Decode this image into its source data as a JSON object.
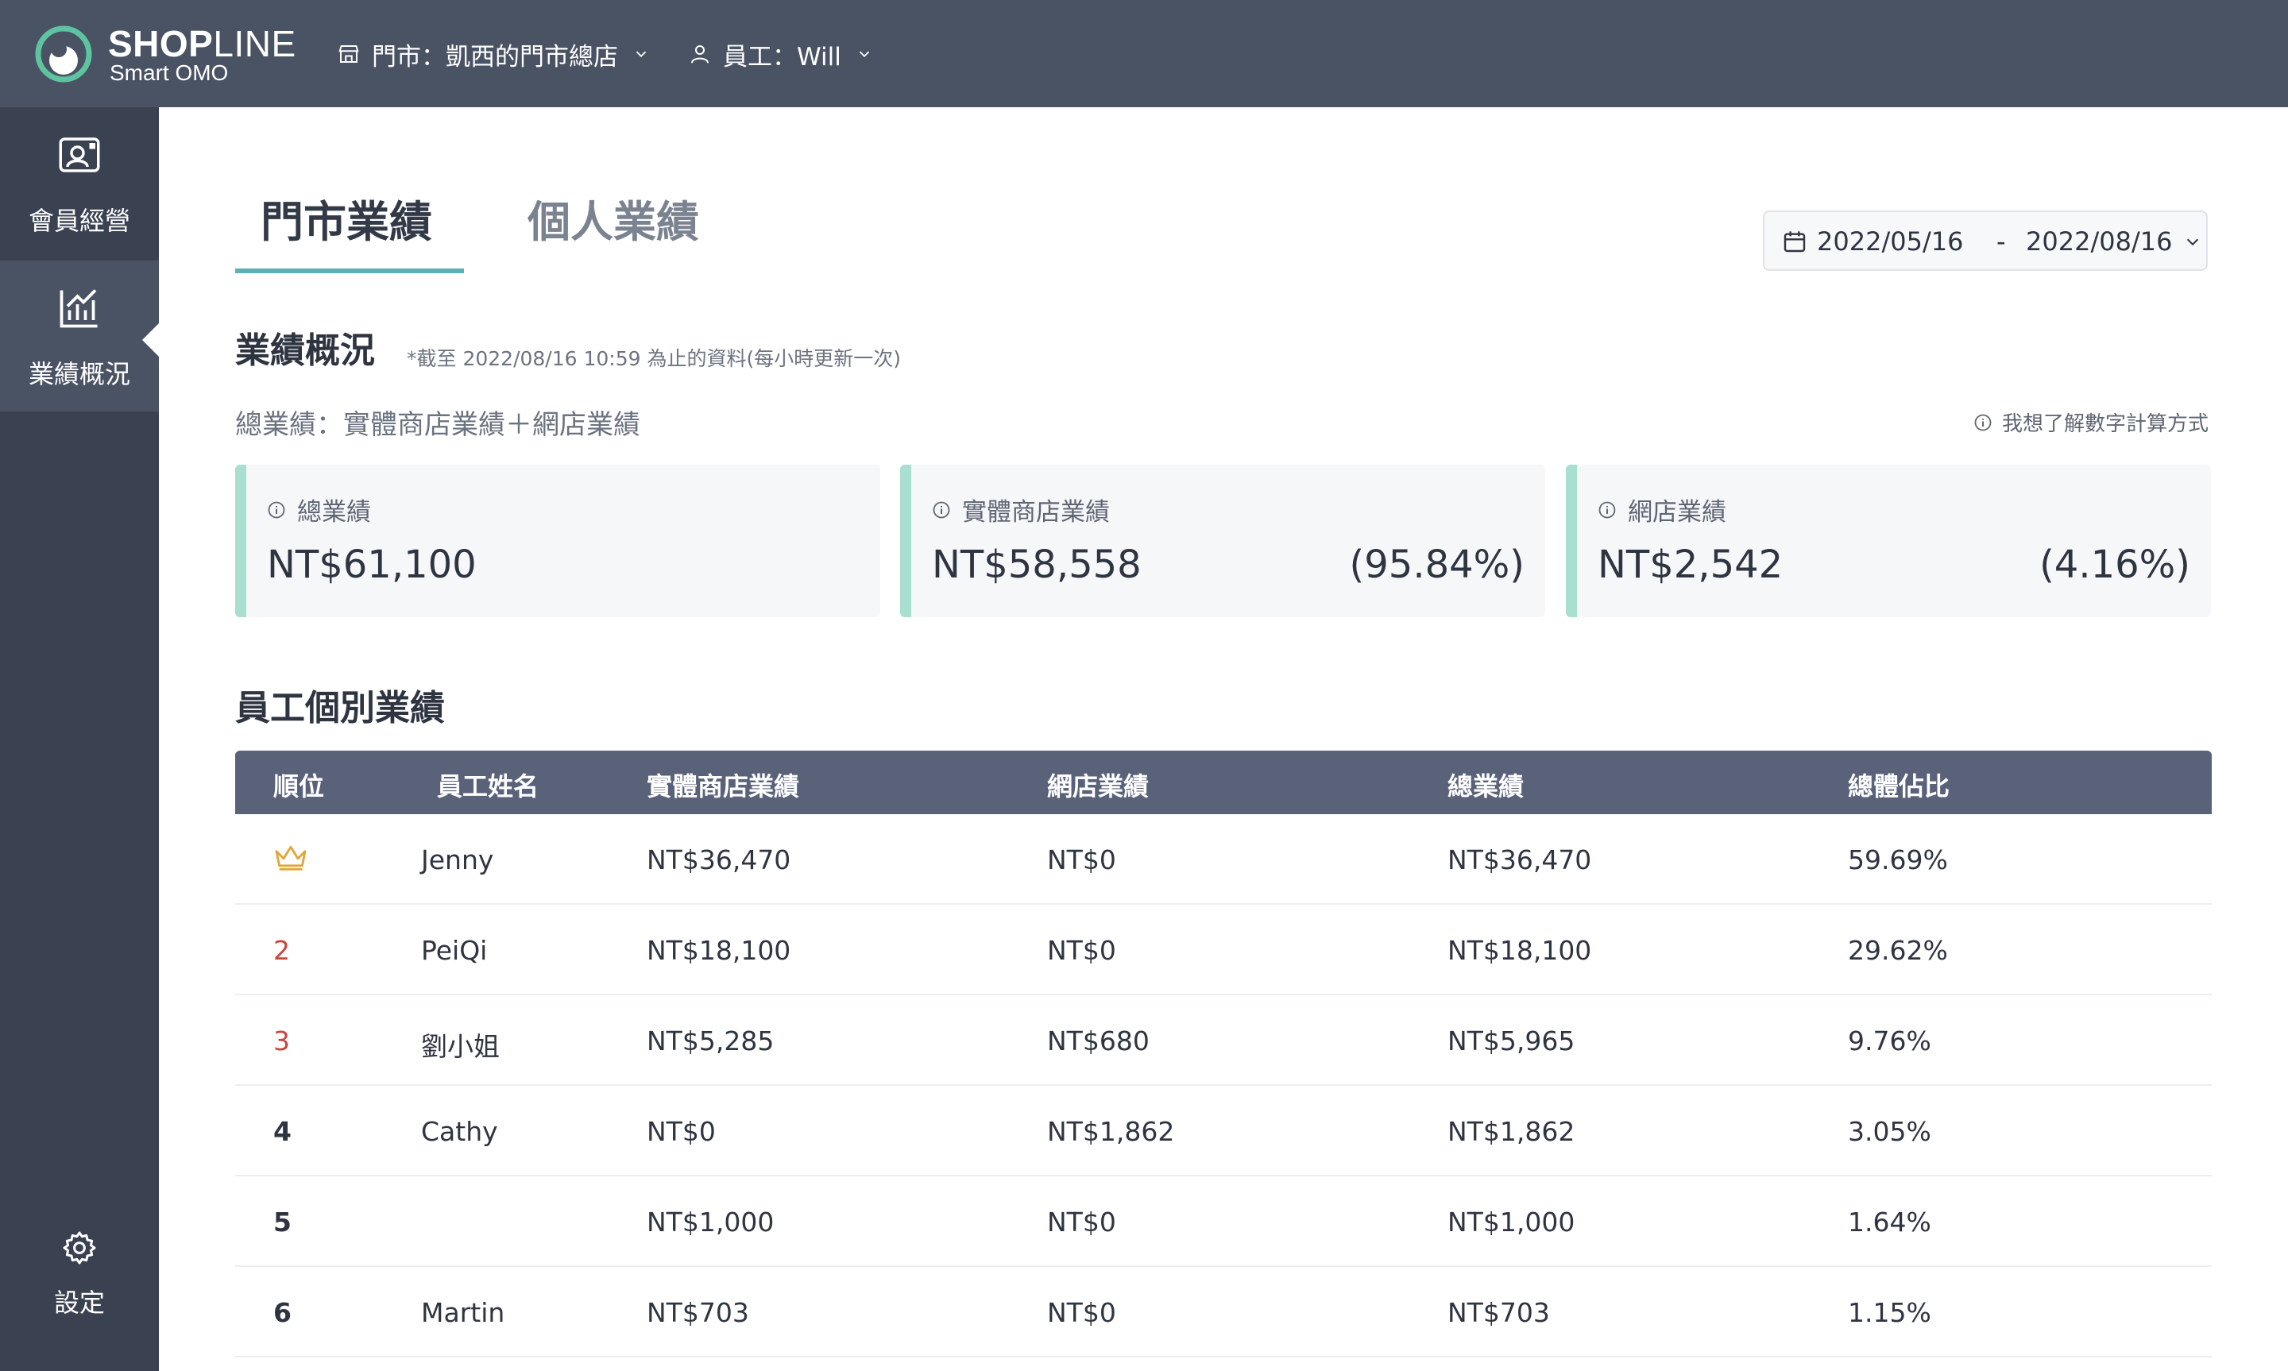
{
  "header": {
    "brand_bold": "SHOP",
    "brand_light": "LINE",
    "brand_sub": "Smart OMO",
    "store_selector": "門市：凱西的門市總店",
    "staff_selector": "員工：Will"
  },
  "sidebar": {
    "items": [
      {
        "label": "會員經營",
        "icon": "member-card-icon"
      },
      {
        "label": "業績概況",
        "icon": "chart-icon",
        "active": true
      },
      {
        "label": "設定",
        "icon": "gear-icon"
      }
    ]
  },
  "tabs": [
    {
      "label": "門市業績",
      "active": true
    },
    {
      "label": "個人業績",
      "active": false
    }
  ],
  "date_range": {
    "start": "2022/05/16",
    "separator": "-",
    "end": "2022/08/16"
  },
  "overview": {
    "title": "業績概況",
    "note": "*截至 2022/08/16 10:59 為止的資料(每小時更新一次)",
    "formula": "總業績：實體商店業績＋網店業績",
    "help_link": "我想了解數字計算方式",
    "cards": [
      {
        "label": "總業績",
        "value": "NT$61,100",
        "pct": ""
      },
      {
        "label": "實體商店業績",
        "value": "NT$58,558",
        "pct": "(95.84%)"
      },
      {
        "label": "網店業績",
        "value": "NT$2,542",
        "pct": "(4.16%)"
      }
    ]
  },
  "staff_table": {
    "title": "員工個別業績",
    "columns": [
      "順位",
      "員工姓名",
      "實體商店業績",
      "網店業績",
      "總業績",
      "總體佔比"
    ],
    "rows": [
      {
        "rank": "",
        "name": "Jenny",
        "store": "NT$36,470",
        "online": "NT$0",
        "total": "NT$36,470",
        "share": "59.69%"
      },
      {
        "rank": "2",
        "name": "PeiQi",
        "store": "NT$18,100",
        "online": "NT$0",
        "total": "NT$18,100",
        "share": "29.62%"
      },
      {
        "rank": "3",
        "name": "劉小姐",
        "store": "NT$5,285",
        "online": "NT$680",
        "total": "NT$5,965",
        "share": "9.76%"
      },
      {
        "rank": "4",
        "name": "Cathy",
        "store": "NT$0",
        "online": "NT$1,862",
        "total": "NT$1,862",
        "share": "3.05%"
      },
      {
        "rank": "5",
        "name": "",
        "store": "NT$1,000",
        "online": "NT$0",
        "total": "NT$1,000",
        "share": "1.64%"
      },
      {
        "rank": "6",
        "name": "Martin",
        "store": "NT$703",
        "online": "NT$0",
        "total": "NT$703",
        "share": "1.15%"
      }
    ]
  },
  "colors": {
    "topbar": "#4a5363",
    "sidebar": "#3a4252",
    "accent": "#5eb0b5",
    "card_border": "#a9dfd0",
    "table_header": "#5a627a",
    "rank_red": "#c9453c",
    "crown": "#e0a83c"
  }
}
